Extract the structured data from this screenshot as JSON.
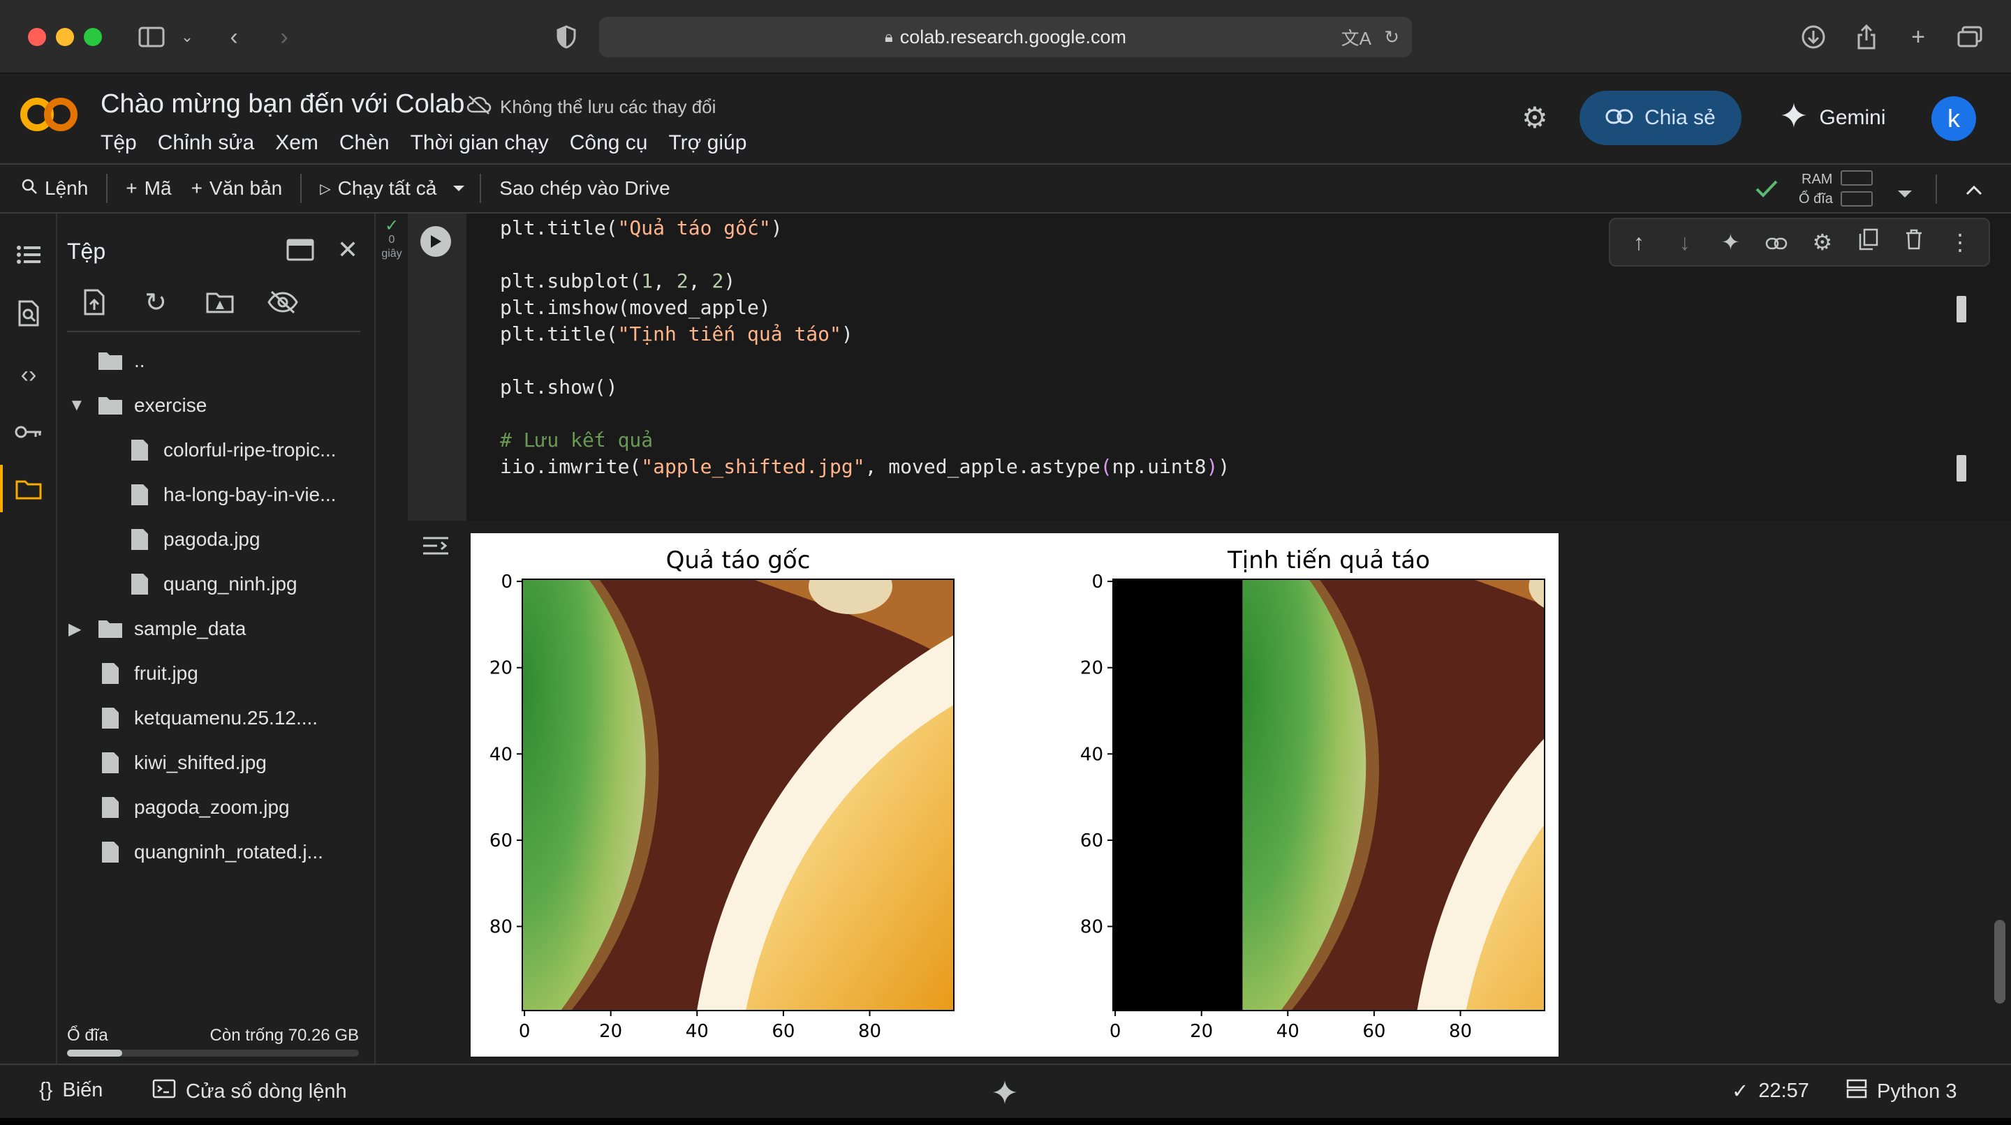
{
  "browser": {
    "url": "colab.research.google.com"
  },
  "header": {
    "title": "Chào mừng bạn đến với Colab",
    "save_warning": "Không thể lưu các thay đổi",
    "menu": [
      "Tệp",
      "Chỉnh sửa",
      "Xem",
      "Chèn",
      "Thời gian chạy",
      "Công cụ",
      "Trợ giúp"
    ],
    "share_label": "Chia sẻ",
    "gemini_label": "Gemini",
    "avatar_letter": "k"
  },
  "toolbar": {
    "commands_label": "Lệnh",
    "code_label": "Mã",
    "text_label": "Văn bản",
    "run_all_label": "Chạy tất cả",
    "copy_drive_label": "Sao chép vào Drive",
    "ram_label": "RAM",
    "disk_label": "Ổ đĩa"
  },
  "files": {
    "title": "Tệp",
    "items": [
      {
        "name": "..",
        "type": "folder-up",
        "depth": 0
      },
      {
        "name": "exercise",
        "type": "folder-open",
        "depth": 0
      },
      {
        "name": "colorful-ripe-tropic...",
        "type": "file",
        "depth": 1
      },
      {
        "name": "ha-long-bay-in-vie...",
        "type": "file",
        "depth": 1
      },
      {
        "name": "pagoda.jpg",
        "type": "file",
        "depth": 1
      },
      {
        "name": "quang_ninh.jpg",
        "type": "file",
        "depth": 1
      },
      {
        "name": "sample_data",
        "type": "folder-closed",
        "depth": 0
      },
      {
        "name": "fruit.jpg",
        "type": "file",
        "depth": 0
      },
      {
        "name": "ketquamenu.25.12....",
        "type": "file",
        "depth": 0
      },
      {
        "name": "kiwi_shifted.jpg",
        "type": "file",
        "depth": 0
      },
      {
        "name": "pagoda_zoom.jpg",
        "type": "file",
        "depth": 0
      },
      {
        "name": "quangninh_rotated.j...",
        "type": "file",
        "depth": 0
      }
    ],
    "disk_label": "Ổ đĩa",
    "disk_free": "Còn trống 70.26 GB",
    "disk_used_fraction": 0.19
  },
  "cell": {
    "exec_time": "0",
    "exec_unit": "giây"
  },
  "figure": {
    "panels": [
      {
        "title": "Quả táo gốc",
        "shift": 0
      },
      {
        "title": "Tịnh tiến quả táo",
        "shift": 30
      }
    ],
    "x_ticks": [
      "0",
      "20",
      "40",
      "60",
      "80"
    ],
    "y_ticks": [
      "0",
      "20",
      "40",
      "60",
      "80"
    ]
  },
  "chart_data": [
    {
      "type": "heatmap",
      "title": "Quả táo gốc",
      "xlim": [
        0,
        100
      ],
      "ylim": [
        100,
        0
      ],
      "x_ticks": [
        0,
        20,
        40,
        60,
        80
      ],
      "y_ticks": [
        0,
        20,
        40,
        60,
        80
      ],
      "content": "image: kiwi slice and orange slice close-up"
    },
    {
      "type": "heatmap",
      "title": "Tịnh tiến quả táo",
      "xlim": [
        0,
        100
      ],
      "ylim": [
        100,
        0
      ],
      "x_ticks": [
        0,
        20,
        40,
        60,
        80
      ],
      "y_ticks": [
        0,
        20,
        40,
        60,
        80
      ],
      "content": "same image translated right by 30 px; columns 0-30 black"
    }
  ],
  "statusbar": {
    "variables_label": "Biến",
    "terminal_label": "Cửa sổ dòng lệnh",
    "time": "22:57",
    "runtime": "Python 3"
  },
  "colors": {
    "accent_orange": "#f9ab00",
    "share_bg": "#1b4d7a",
    "avatar_bg": "#1a73e8"
  }
}
